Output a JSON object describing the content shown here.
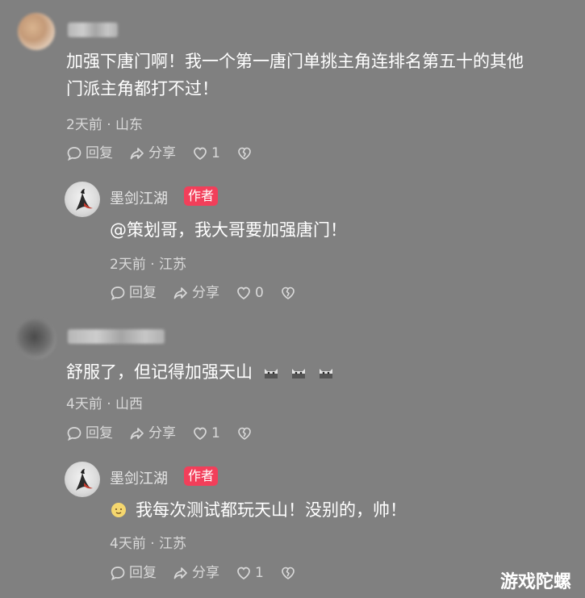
{
  "comments": [
    {
      "text_line1": "加强下唐门啊！我一个第一唐门单挑主角连排名第五十的其他",
      "text_line2": "门派主角都打不过！",
      "meta": "2天前 · 山东",
      "reply_label": "回复",
      "share_label": "分享",
      "like_count": "1",
      "reply": {
        "username": "墨剑江湖",
        "badge": "作者",
        "text": "@策划哥，我大哥要加强唐门！",
        "meta": "2天前 · 江苏",
        "reply_label": "回复",
        "share_label": "分享",
        "like_count": "0"
      }
    },
    {
      "text": "舒服了，但记得加强天山",
      "meta": "4天前 · 山西",
      "reply_label": "回复",
      "share_label": "分享",
      "like_count": "1",
      "reply": {
        "username": "墨剑江湖",
        "badge": "作者",
        "text": "我每次测试都玩天山！没别的，帅！",
        "meta": "4天前 · 江苏",
        "reply_label": "回复",
        "share_label": "分享",
        "like_count": "1"
      }
    }
  ],
  "watermark": "游戏陀螺",
  "colors": {
    "background": "#808080",
    "badge": "#f23f5a",
    "text": "#ffffff",
    "meta": "#d9d9d9"
  }
}
